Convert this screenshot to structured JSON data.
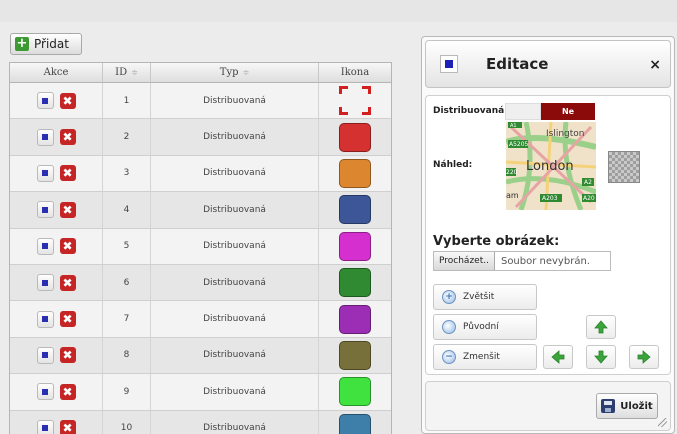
{
  "toolbar": {
    "add_label": "Přidat"
  },
  "grid": {
    "columns": {
      "akce": "Akce",
      "id": "ID",
      "typ": "Typ",
      "ikona": "Ikona"
    },
    "sort_glyph": "≑",
    "rows": [
      {
        "id": "1",
        "typ": "Distribuovaná",
        "icon": "marker",
        "color": "#d21f1f"
      },
      {
        "id": "2",
        "typ": "Distribuovaná",
        "icon": "swatch",
        "color": "#d53131"
      },
      {
        "id": "3",
        "typ": "Distribuovaná",
        "icon": "swatch",
        "color": "#dd8630"
      },
      {
        "id": "4",
        "typ": "Distribuovaná",
        "icon": "swatch",
        "color": "#3c5698"
      },
      {
        "id": "5",
        "typ": "Distribuovaná",
        "icon": "swatch",
        "color": "#d62fcf"
      },
      {
        "id": "6",
        "typ": "Distribuovaná",
        "icon": "swatch",
        "color": "#2f8a32"
      },
      {
        "id": "7",
        "typ": "Distribuovaná",
        "icon": "swatch",
        "color": "#9b2eb4"
      },
      {
        "id": "8",
        "typ": "Distribuovaná",
        "icon": "swatch",
        "color": "#77703a"
      },
      {
        "id": "9",
        "typ": "Distribuovaná",
        "icon": "swatch",
        "color": "#3fe23f"
      },
      {
        "id": "10",
        "typ": "Distribuovaná",
        "icon": "swatch",
        "color": "#3d7fa8"
      }
    ]
  },
  "editor": {
    "title": "Editace",
    "close": "×",
    "distributed_label": "Distribuovaná:",
    "distributed_value": "Ne",
    "preview_label": "Náhled:",
    "map_labels": {
      "islington": "Islington",
      "london": "London",
      "a205": "A5205",
      "a1": "A1",
      "a220": "220",
      "am": "am",
      "a203": "A203",
      "a2": "A2",
      "a20": "A20"
    },
    "select_title": "Vyberte obrázek:",
    "browse": "Procházet..",
    "file_status": "Soubor nevybrán.",
    "zoom_in": "Zvětšit",
    "original": "Původní",
    "zoom_out": "Zmenšit",
    "save": "Uložit"
  }
}
